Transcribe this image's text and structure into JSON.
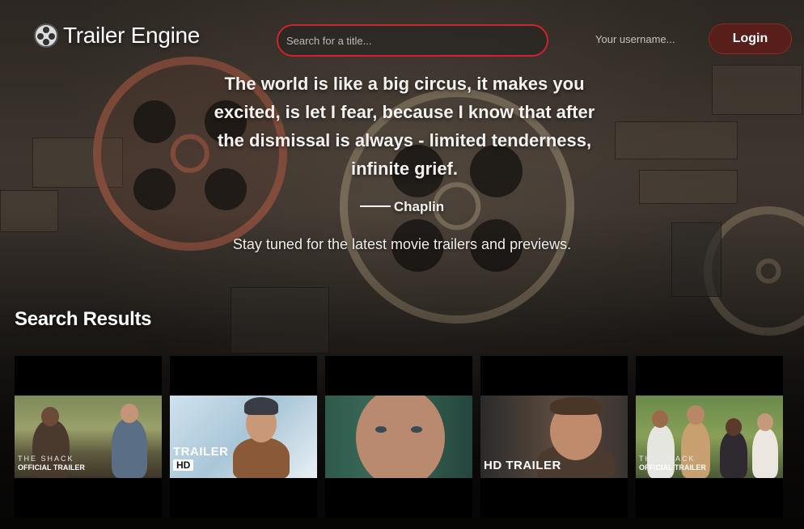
{
  "header": {
    "app_title": "Trailer Engine",
    "search_placeholder": "Search for a title...",
    "username_placeholder": "Your username...",
    "login_label": "Login"
  },
  "hero": {
    "quote": "The world is like a big circus, it makes you excited, is let I fear, because I know that after the dismissal is always - limited tenderness, infinite grief.",
    "author": "Chaplin",
    "tagline": "Stay tuned for the latest movie trailers and previews."
  },
  "results": {
    "title": "Search Results",
    "items": [
      {
        "overlay_small": "THE SHACK",
        "overlay_label": "OFFICIAL TRAILER",
        "overlay_big": "",
        "overlay_badge": ""
      },
      {
        "overlay_small": "",
        "overlay_label": "",
        "overlay_big": "TRAILER",
        "overlay_badge": "HD"
      },
      {
        "overlay_small": "",
        "overlay_label": "",
        "overlay_big": "",
        "overlay_badge": ""
      },
      {
        "overlay_small": "",
        "overlay_label": "",
        "overlay_big": "HD TRAILER",
        "overlay_badge": ""
      },
      {
        "overlay_small": "THE SHACK",
        "overlay_label": "OFFICIAL TRAILER",
        "overlay_big": "",
        "overlay_badge": ""
      }
    ]
  },
  "colors": {
    "search_border": "#d0232b",
    "login_bg": "#5f1c18",
    "card_bg": "#000000"
  },
  "icons": {
    "logo": "film-reel-icon"
  }
}
